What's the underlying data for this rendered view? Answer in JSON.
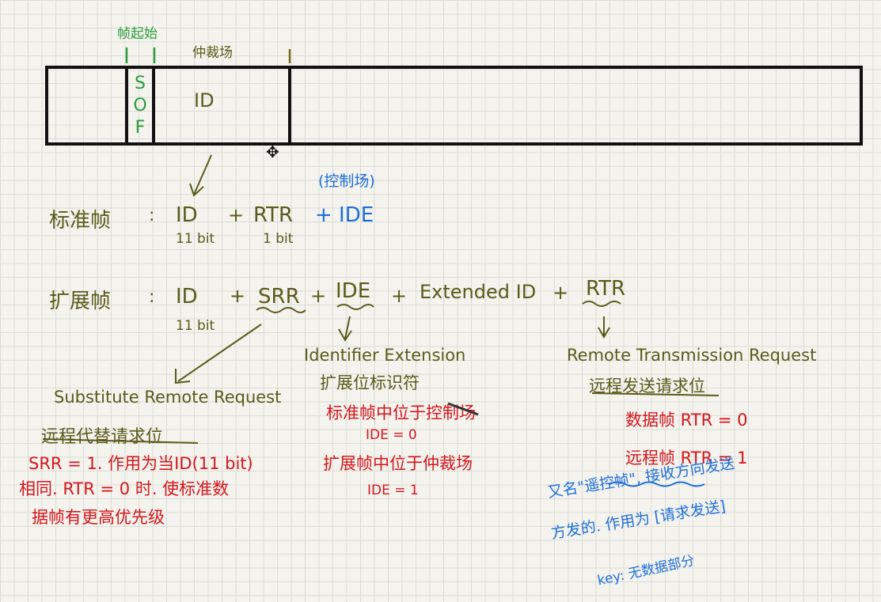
{
  "frame": {
    "sof_label": "帧起始",
    "arb_label": "仲裁场",
    "sof_letters": [
      "S",
      "O",
      "F"
    ],
    "id_label": "ID"
  },
  "standard": {
    "label": "标准帧",
    "eq": ":",
    "id": "ID",
    "plus1": "+",
    "rtr": "RTR",
    "plus2": "+ IDE",
    "id_bits": "11 bit",
    "rtr_bits": "1 bit",
    "control_note": "(控制场)"
  },
  "extended": {
    "label": "扩展帧",
    "eq": ":",
    "id": "ID",
    "plus1": "+",
    "srr": "SRR",
    "plus2": "+",
    "ide": "IDE",
    "plus3": "+",
    "ext_id": "Extended ID",
    "plus4": "+",
    "rtr": "RTR",
    "id_bits": "11 bit"
  },
  "srr_note": {
    "en": "Substitute Remote Request",
    "cn": "远程代替请求位",
    "red1": "SRR = 1. 作用为当ID(11 bit)",
    "red2": "相同. RTR = 0 时. 使标准数",
    "red3": "据帧有更高优先级"
  },
  "ide_note": {
    "en": "Identifier Extension",
    "cn": "扩展位标识符",
    "red1": "标准帧中位于控制场",
    "red1b": "IDE = 0",
    "red2": "扩展帧中位于仲裁场",
    "red2b": "IDE = 1"
  },
  "rtr_note": {
    "en": "Remote Transmission Request",
    "cn": "远程发送请求位",
    "red1": "数据帧 RTR = 0",
    "red2": "远程帧 RTR = 1",
    "blue1": "又名\"遥控帧\", 接收方向发送",
    "blue2": "方发的. 作用为 [请求发送]",
    "blue3": "key: 无数据部分"
  }
}
